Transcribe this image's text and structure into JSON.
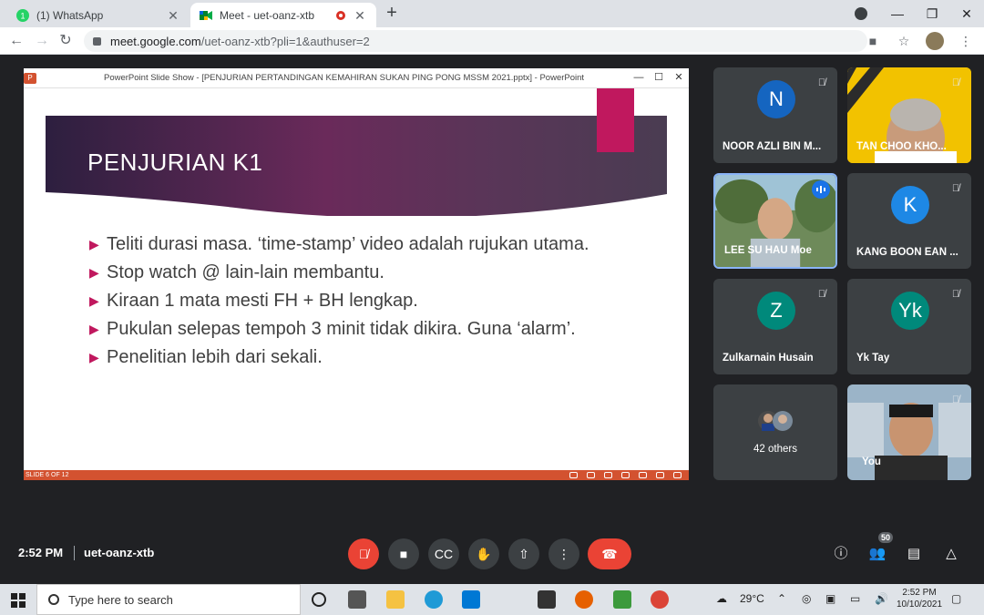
{
  "browser": {
    "tabs": [
      {
        "title": "(1) WhatsApp",
        "badge": "1"
      },
      {
        "title": "Meet - uet-oanz-xtb"
      }
    ],
    "new_tab_label": "+",
    "url_host": "meet.google.com",
    "url_path": "/uet-oanz-xtb?pli=1&authuser=2"
  },
  "ppt": {
    "window_title": "PowerPoint Slide Show - [PENJURIAN PERTANDINGAN KEMAHIRAN SUKAN PING PONG MSSM 2021.pptx] - PowerPoint",
    "slide_heading": "PENJURIAN K1",
    "bullets": [
      "Teliti durasi masa. ‘time-stamp’ video adalah rujukan utama.",
      "Stop watch @ lain-lain membantu.",
      "Kiraan 1 mata mesti FH + BH lengkap.",
      "Pukulan selepas tempoh 3 minit tidak dikira. Guna ‘alarm’.",
      "Penelitian lebih dari sekali."
    ],
    "status": "SLIDE 6 OF 12"
  },
  "participants": [
    {
      "initial": "N",
      "name": "NOOR AZLI BIN M...",
      "color": "#1565c0"
    },
    {
      "name": "TAN CHOO KHO..."
    },
    {
      "name": "LEE SU HAU Moe"
    },
    {
      "initial": "K",
      "name": "KANG BOON EAN ...",
      "color": "#1e88e5"
    },
    {
      "initial": "Z",
      "name": "Zulkarnain Husain",
      "color": "#00897b"
    },
    {
      "initial": "Yk",
      "name": "Yk Tay",
      "color": "#00897b"
    },
    {
      "name": "42 others"
    },
    {
      "name": "You"
    }
  ],
  "meeting": {
    "time": "2:52 PM",
    "code": "uet-oanz-xtb",
    "people_count": "50"
  },
  "taskbar": {
    "search_placeholder": "Type here to search",
    "weather": "29°C",
    "time": "2:52 PM",
    "date": "10/10/2021"
  }
}
